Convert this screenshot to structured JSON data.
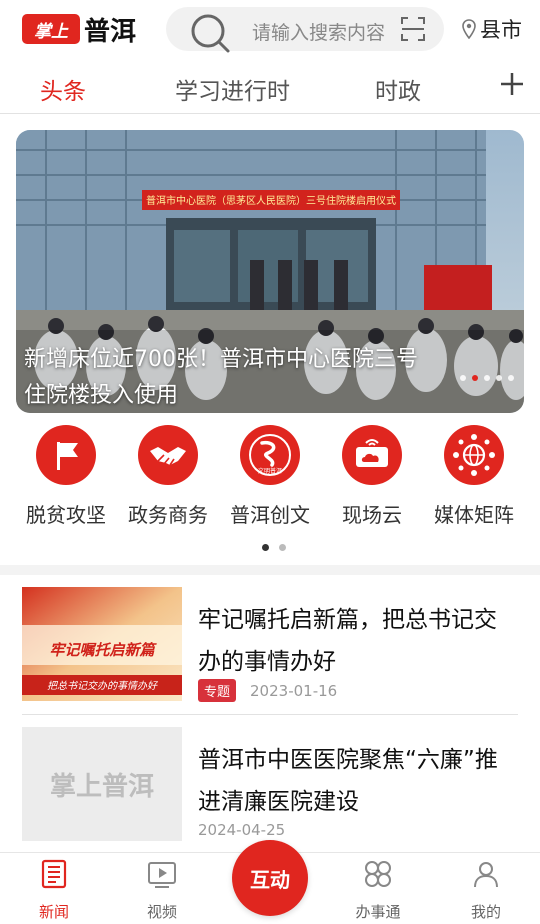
{
  "header": {
    "logo_badge": "掌上",
    "logo_text": "普洱",
    "search_placeholder": "请输入搜索内容",
    "county_label": "县市"
  },
  "tabs": [
    {
      "label": "头条",
      "active": true
    },
    {
      "label": "学习进行时",
      "active": false
    },
    {
      "label": "时政",
      "active": false
    }
  ],
  "banner": {
    "caption": "新增床位近700张！普洱市中心医院三号住院楼投入使用",
    "sign_text": "普洱市中心医院（思茅区人民医院）三号住院楼启用仪式",
    "slide_count": 5,
    "active_slide": 1
  },
  "channels": [
    {
      "label": "脱贫攻坚",
      "icon": "flag-icon"
    },
    {
      "label": "政务商务",
      "icon": "handshake-icon"
    },
    {
      "label": "普洱创文",
      "icon": "civilization-icon",
      "icon_text": "文明普洱"
    },
    {
      "label": "现场云",
      "icon": "cloud-screen-icon"
    },
    {
      "label": "媒体矩阵",
      "icon": "network-globe-icon"
    }
  ],
  "channel_pages": {
    "count": 2,
    "active": 0
  },
  "news": [
    {
      "title": "牢记嘱托启新篇，把总书记交办的事情办好",
      "tag": "专题",
      "date": "2023-01-16",
      "thumb_line1": "牢记嘱托启新篇",
      "thumb_line2": "把总书记交办的事情办好"
    },
    {
      "title": "普洱市中医医院聚焦“六廉”推进清廉医院建设",
      "date": "2024-04-25",
      "thumb_text": "掌上普洱"
    }
  ],
  "bottom_nav": [
    {
      "label": "新闻",
      "icon": "news-icon",
      "active": true
    },
    {
      "label": "视频",
      "icon": "video-icon",
      "active": false
    },
    {
      "label": "办事通",
      "icon": "services-icon",
      "active": false
    },
    {
      "label": "我的",
      "icon": "profile-icon",
      "active": false
    }
  ],
  "center_button": "互动",
  "colors": {
    "accent": "#e0261f",
    "tag": "#d7313b"
  }
}
